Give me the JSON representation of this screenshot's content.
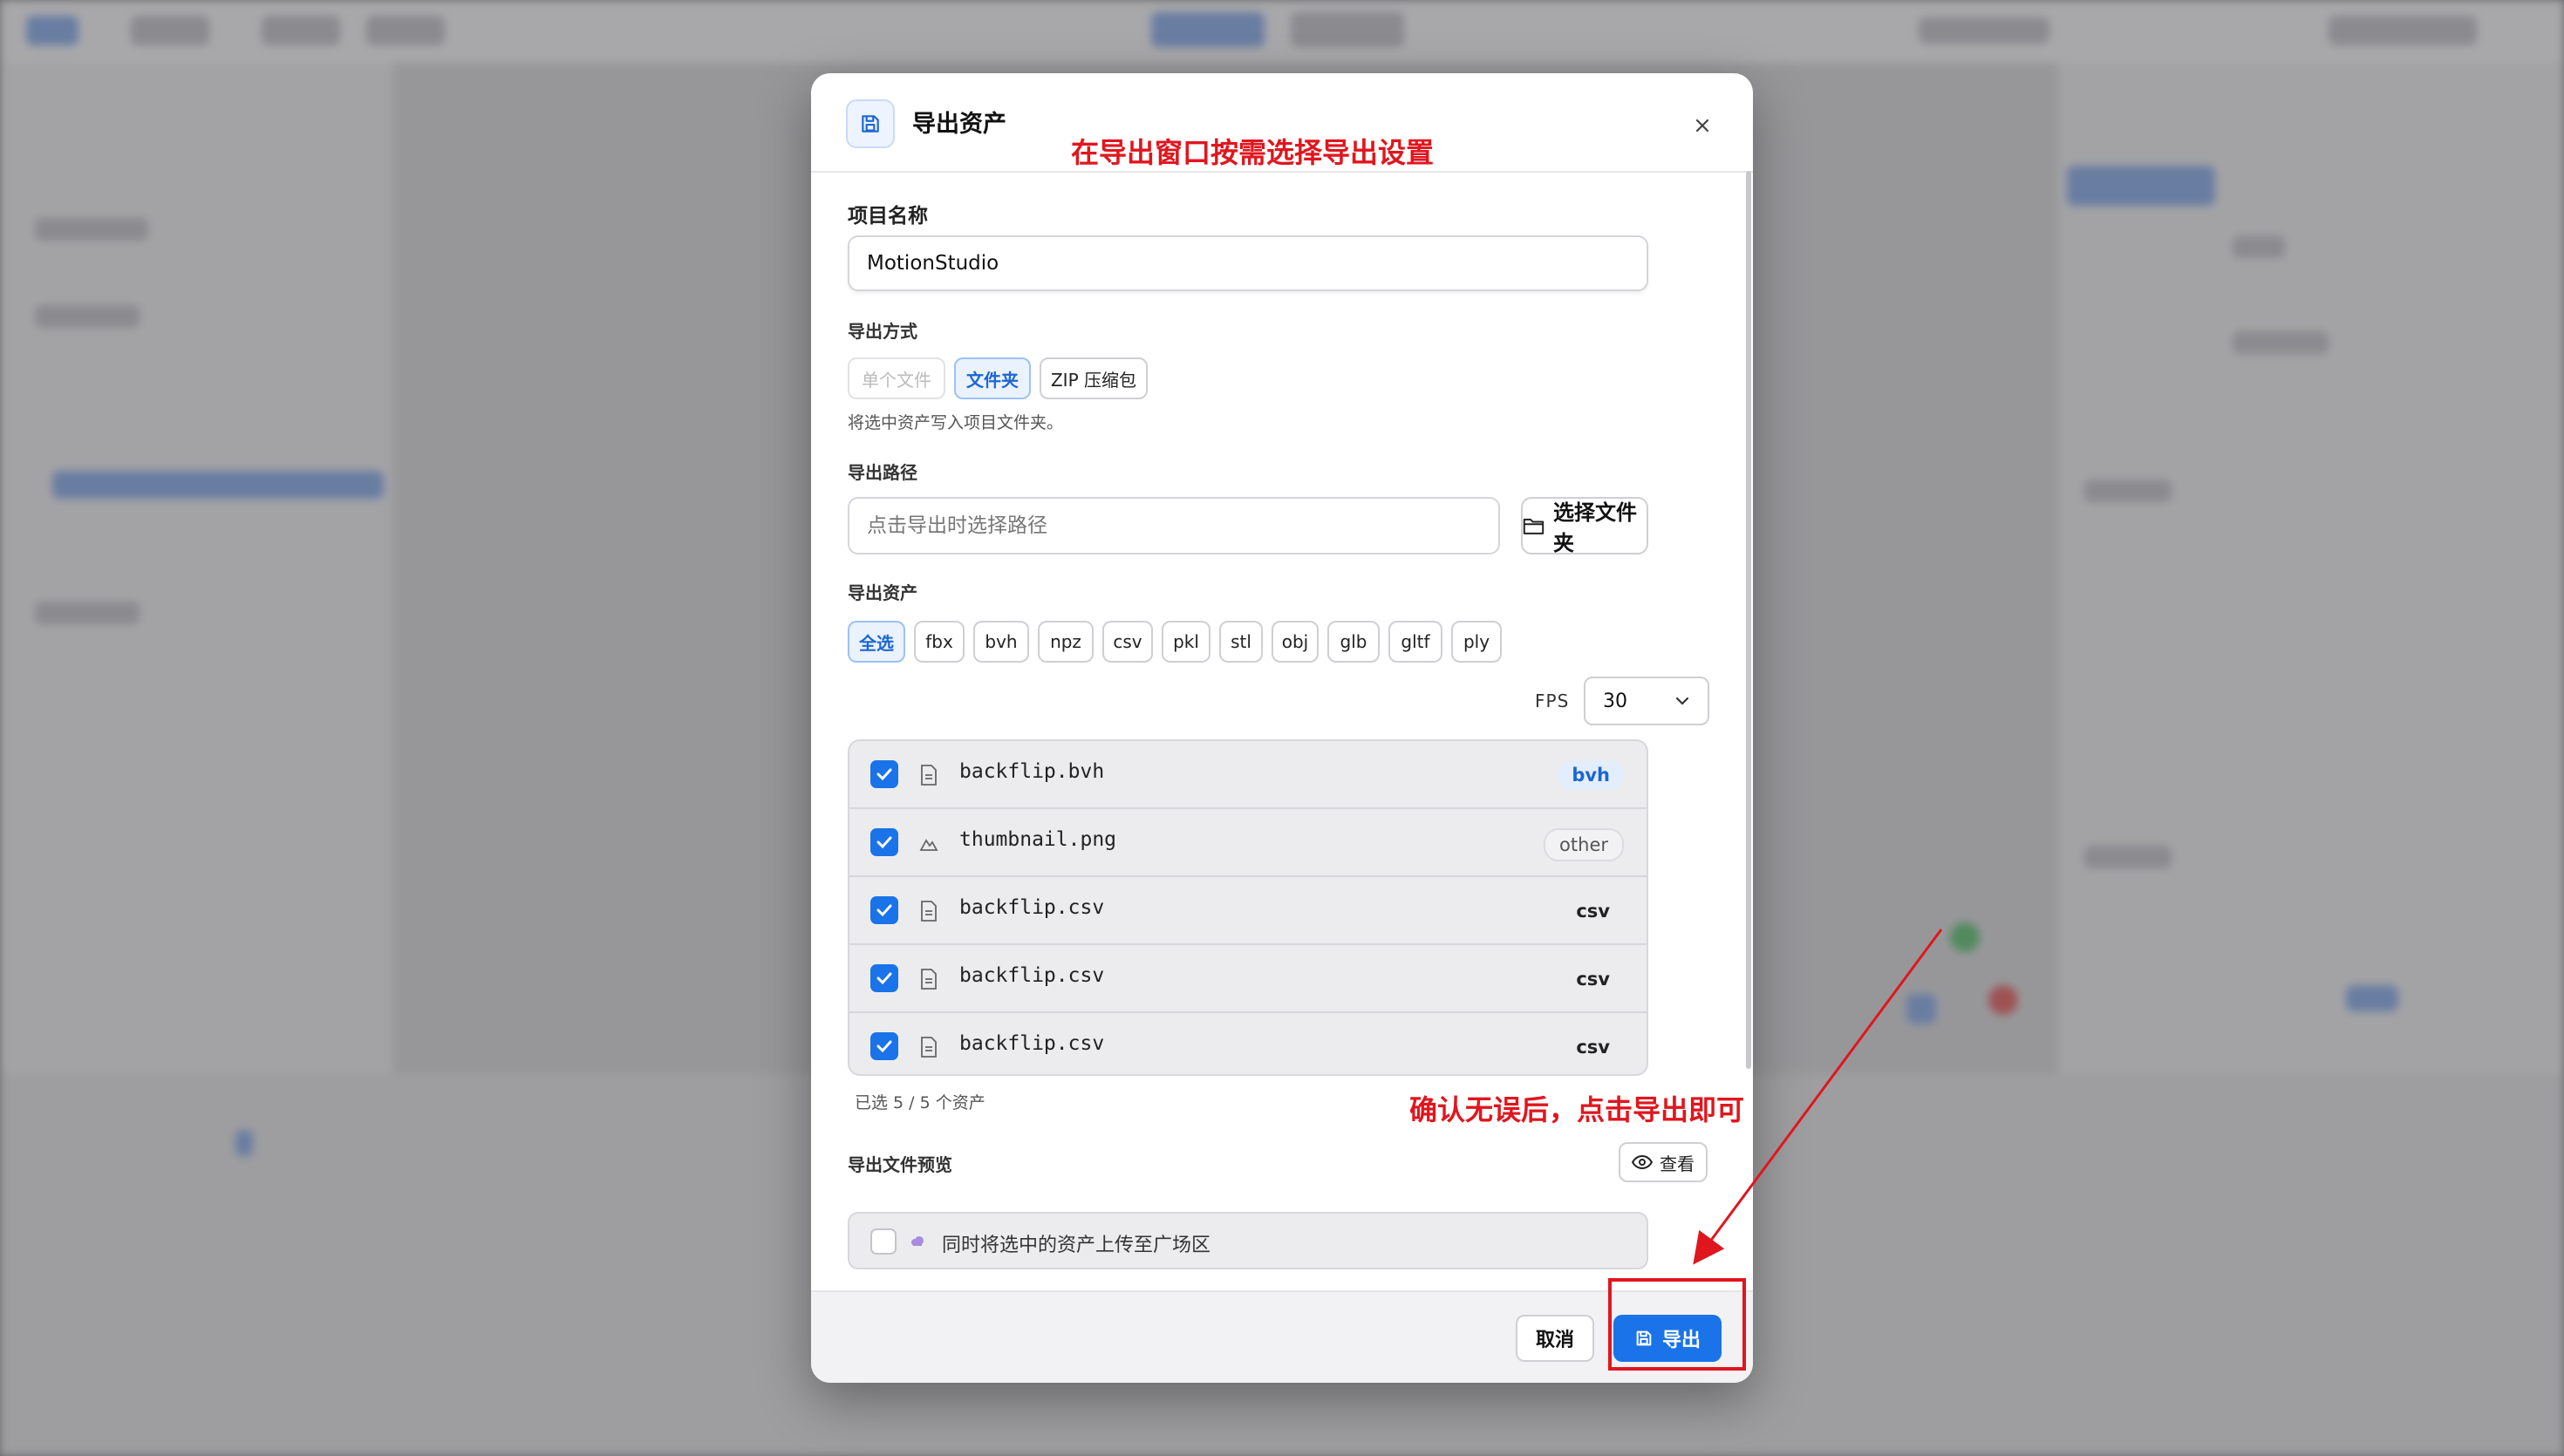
{
  "dialog": {
    "title": "导出资产",
    "project_name_label": "项目名称",
    "project_name_value": "MotionStudio",
    "export_mode_label": "导出方式",
    "export_modes": [
      "单个文件",
      "文件夹",
      "ZIP 压缩包"
    ],
    "export_mode_selected": "文件夹",
    "export_mode_hint": "将选中资产写入项目文件夹。",
    "export_path_label": "导出路径",
    "export_path_placeholder": "点击导出时选择路径",
    "choose_folder_label": "选择文件夹",
    "export_assets_label": "导出资产",
    "format_filters": [
      "全选",
      "fbx",
      "bvh",
      "npz",
      "csv",
      "pkl",
      "stl",
      "obj",
      "glb",
      "gltf",
      "ply"
    ],
    "fps_label": "FPS",
    "fps_value": "30",
    "files": [
      {
        "name": "backflip.bvh",
        "type": "bvh",
        "checked": true
      },
      {
        "name": "thumbnail.png",
        "type": "other",
        "checked": true
      },
      {
        "name": "backflip.csv",
        "type": "csv",
        "checked": true
      },
      {
        "name": "backflip.csv",
        "type": "csv",
        "checked": true
      },
      {
        "name": "backflip.csv",
        "type": "csv",
        "checked": true
      }
    ],
    "selection_count": "已选 5 / 5 个资产",
    "preview_label": "导出文件预览",
    "view_label": "查看",
    "upload_label": "同时将选中的资产上传至广场区",
    "cancel_label": "取消",
    "export_label": "导出"
  },
  "annotations": {
    "top_note": "在导出窗口按需选择导出设置",
    "bottom_note": "确认无误后，点击导出即可",
    "color": "#e0161e"
  },
  "colors": {
    "accent": "#1a73e8",
    "scrim": "#7d7d80"
  }
}
